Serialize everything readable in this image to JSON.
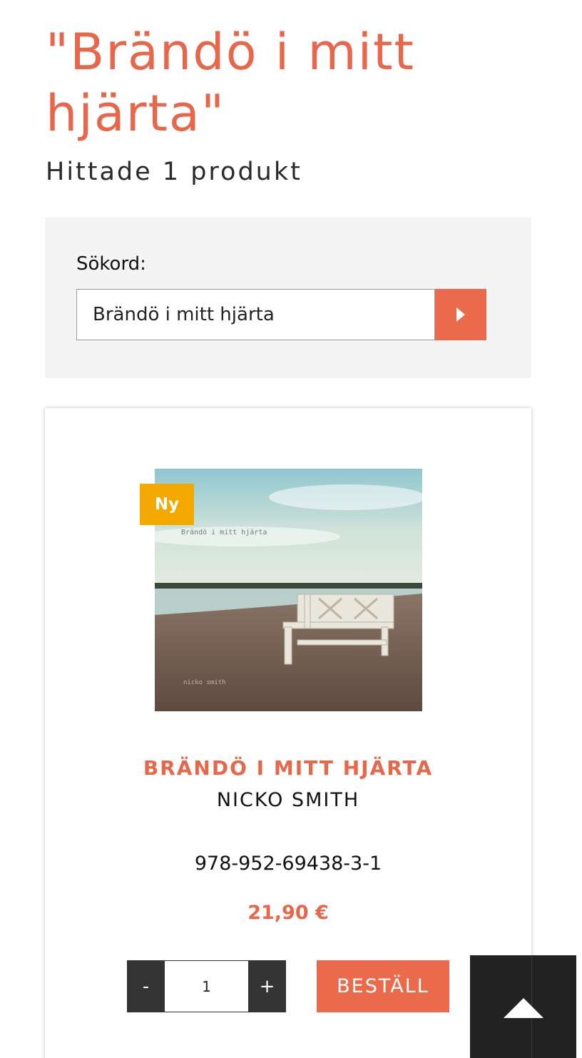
{
  "page": {
    "title": "\"Brändö i mitt hjärta\"",
    "result_count": "Hittade 1 produkt"
  },
  "search": {
    "label": "Sökord:",
    "value": "Brändö i mitt hjärta",
    "button_icon": "chevron-right-icon"
  },
  "product": {
    "badge": "Ny",
    "cover_text_title": "Brändö i mitt hjärta",
    "cover_text_author": "nicko smith",
    "title": "BRÄNDÖ I MITT HJÄRTA",
    "author": "NICKO SMITH",
    "isbn": "978-952-69438-3-1",
    "price": "21,90 €",
    "quantity": "1",
    "decrement_label": "-",
    "increment_label": "+",
    "order_label": "BESTÄLL"
  },
  "scroll_top": {
    "icon": "triangle-up-icon"
  },
  "colors": {
    "accent": "#e8674a",
    "button": "#ec6a4c",
    "badge": "#f4a900",
    "dark": "#222222",
    "panel": "#f4f4f4"
  }
}
